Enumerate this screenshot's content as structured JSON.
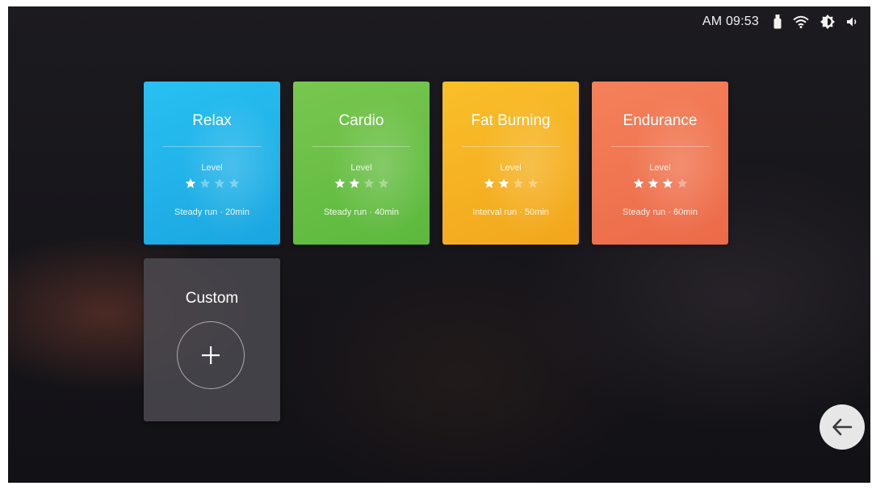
{
  "status_bar": {
    "time": "AM 09:53",
    "icons": [
      "usb-icon",
      "wifi-icon",
      "brightness-icon",
      "volume-icon"
    ]
  },
  "programs": [
    {
      "title": "Relax",
      "level_label": "Level",
      "level": 1,
      "max_level": 4,
      "description": "Steady run · 20min",
      "color": "#22b6ea"
    },
    {
      "title": "Cardio",
      "level_label": "Level",
      "level": 2,
      "max_level": 4,
      "description": "Steady run · 40min",
      "color": "#6cc047"
    },
    {
      "title": "Fat Burning",
      "level_label": "Level",
      "level": 2,
      "max_level": 4,
      "description": "Interval run · 50min",
      "color": "#f6b320"
    },
    {
      "title": "Endurance",
      "level_label": "Level",
      "level": 3,
      "max_level": 4,
      "description": "Steady run · 60min",
      "color": "#f0764f"
    }
  ],
  "custom": {
    "title": "Custom",
    "add_icon": "plus-icon"
  },
  "navigation": {
    "back_icon": "arrow-left-icon"
  }
}
